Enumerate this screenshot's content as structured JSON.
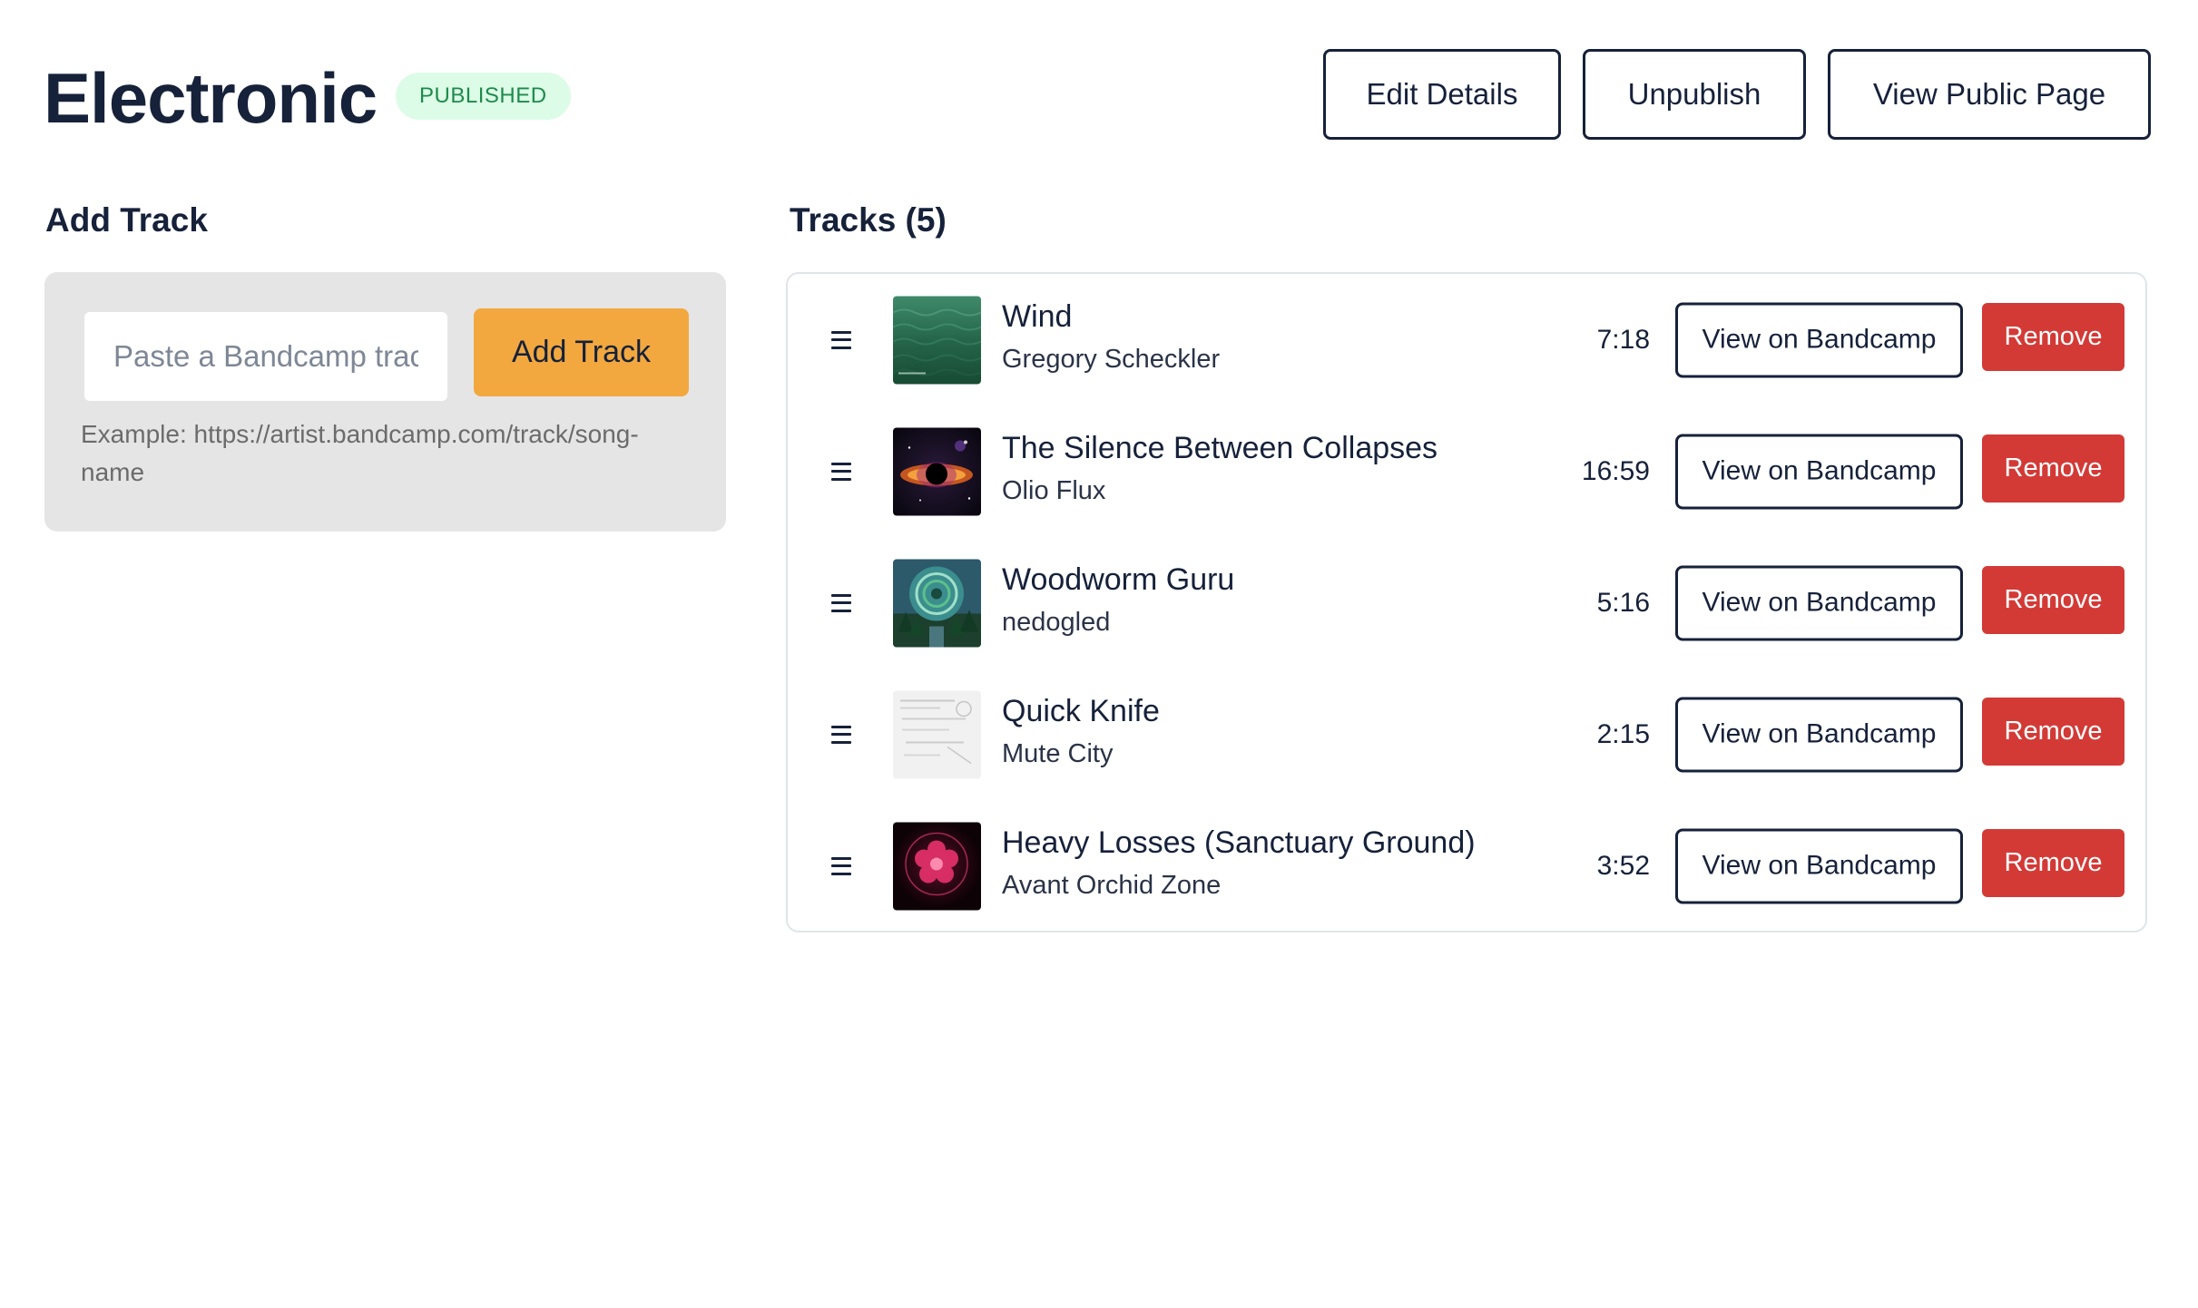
{
  "header": {
    "title": "Electronic",
    "status": "PUBLISHED",
    "actions": {
      "edit": "Edit Details",
      "unpublish": "Unpublish",
      "view_public": "View Public Page"
    }
  },
  "add_track": {
    "heading": "Add Track",
    "placeholder": "Paste a Bandcamp track URL",
    "button": "Add Track",
    "example": "Example: https://artist.bandcamp.com/track/song-name"
  },
  "tracks": {
    "heading": "Tracks (5)",
    "view_label": "View on Bandcamp",
    "remove_label": "Remove",
    "items": [
      {
        "title": "Wind",
        "artist": "Gregory Scheckler",
        "duration": "7:18",
        "art": "green-sea-art"
      },
      {
        "title": "The Silence Between Collapses",
        "artist": "Olio Flux",
        "duration": "16:59",
        "art": "black-hole-art"
      },
      {
        "title": "Woodworm Guru",
        "artist": "nedogled",
        "duration": "5:16",
        "art": "forest-vortex-art"
      },
      {
        "title": "Quick Knife",
        "artist": "Mute City",
        "duration": "2:15",
        "art": "sketch-paper-art"
      },
      {
        "title": "Heavy Losses (Sanctuary Ground)",
        "artist": "Avant Orchid Zone",
        "duration": "3:52",
        "art": "pink-neon-flower-art"
      }
    ]
  },
  "colors": {
    "text": "#16213a",
    "accent": "#f2a83f",
    "danger": "#d33a36",
    "badge_bg": "#dcfce7",
    "badge_text": "#1f8a4c"
  }
}
